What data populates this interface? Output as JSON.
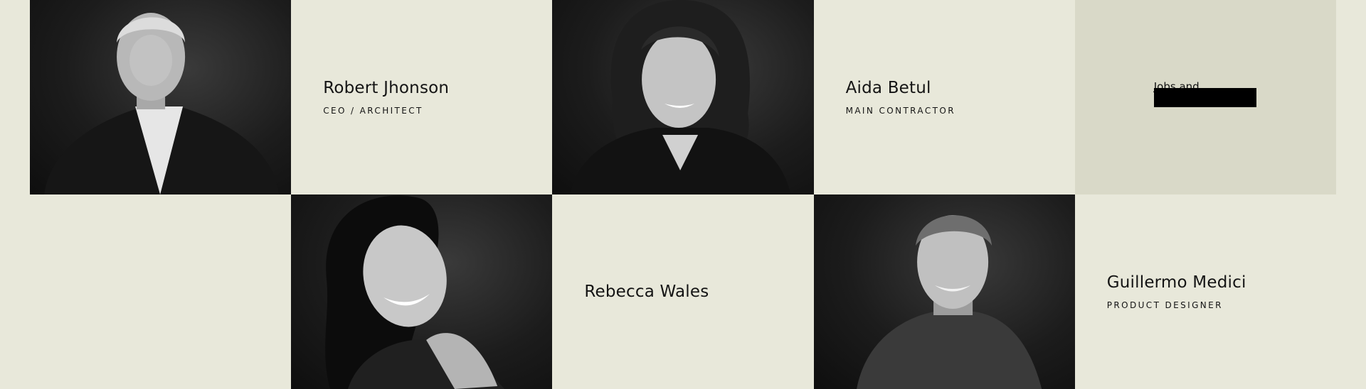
{
  "team": {
    "members": [
      {
        "name": "Robert Jhonson",
        "role": "CEO / ARCHITECT"
      },
      {
        "name": "Aida Betul",
        "role": "MAIN CONTRACTOR"
      },
      {
        "name": "Rebecca Wales",
        "role": ""
      },
      {
        "name": "Guillermo Medici",
        "role": "PRODUCT DESIGNER"
      }
    ],
    "cta": {
      "label": "Jobs and internships"
    }
  },
  "colors": {
    "page_background": "#e8e8da",
    "cta_background": "#d9d9c8",
    "text": "#141414"
  }
}
